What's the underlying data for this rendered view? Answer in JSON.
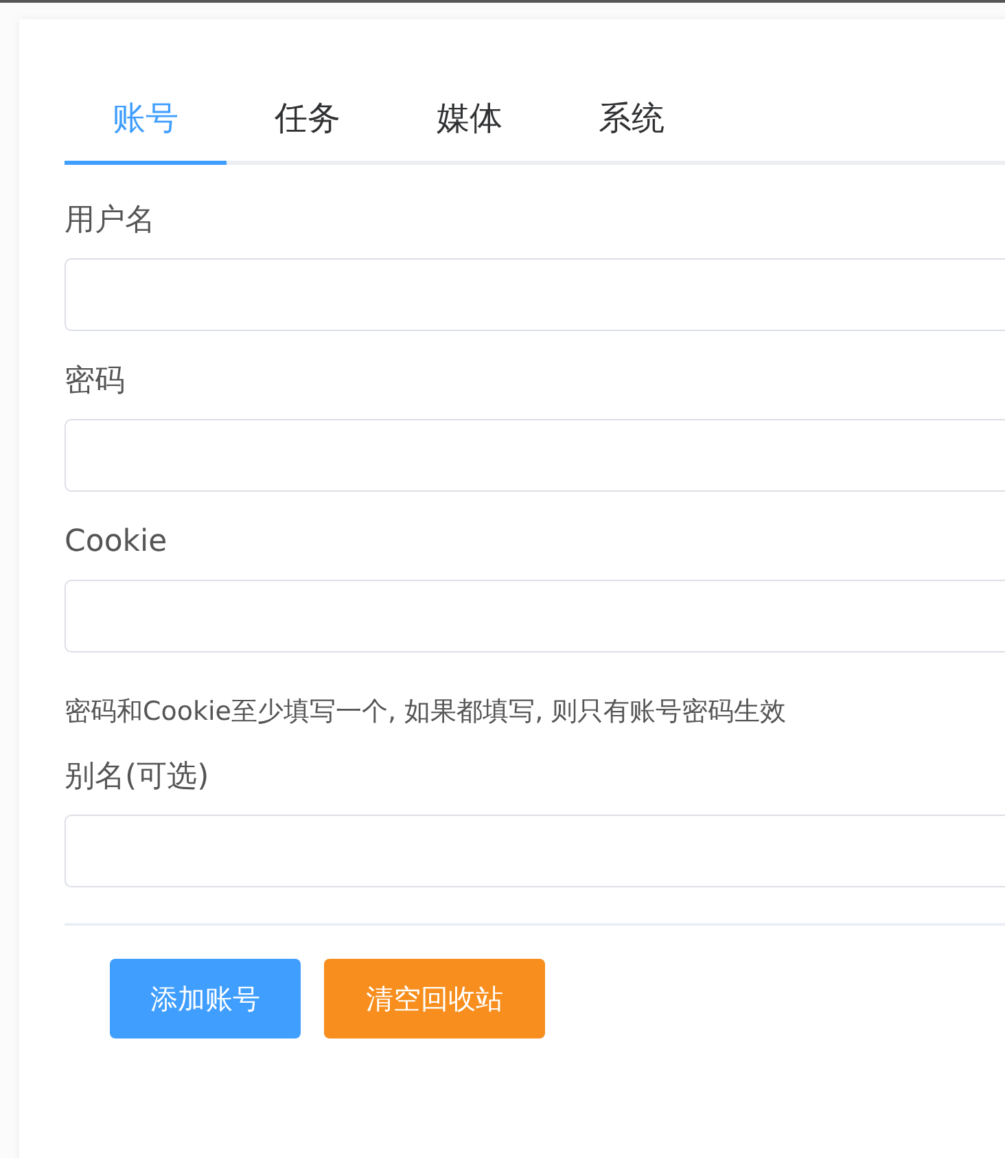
{
  "tabs": [
    {
      "label": "账号",
      "selected": true
    },
    {
      "label": "任务",
      "selected": false
    },
    {
      "label": "媒体",
      "selected": false
    },
    {
      "label": "系统",
      "selected": false
    }
  ],
  "fields": [
    {
      "label": "用户名"
    },
    {
      "label": "密码"
    },
    {
      "label": "Cookie"
    },
    {
      "kind": "hint",
      "text": "密码和Cookie至少填写一个, 如果都填写, 则只有账号密码生效"
    },
    {
      "label": "别名(可选)"
    }
  ],
  "buttons": [
    {
      "label": "添加账号",
      "kind": "primary"
    },
    {
      "label": "清空回收站",
      "kind": "warning"
    }
  ]
}
